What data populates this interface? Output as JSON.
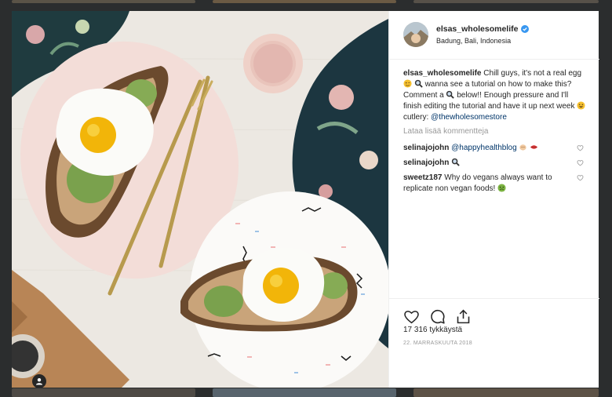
{
  "post": {
    "username": "elsas_wholesomelife",
    "location": "Badung, Bali, Indonesia",
    "caption": {
      "user": "elsas_wholesomelife",
      "text_1": "Chill guys, it's not a real egg",
      "text_2": "wanna see a tutorial on how to make this? Comment a",
      "text_3": "below!! Enough pressure and I'll finish editing the tutorial and have it up next week",
      "text_4": "cutlery:",
      "mention": "@thewholesomestore"
    },
    "load_more_label": "Lataa lisää kommentteja",
    "comments": [
      {
        "user": "selinajojohn",
        "text": "",
        "mention": "@happyhealthblog"
      },
      {
        "user": "selinajojohn",
        "text": "",
        "mention": ""
      },
      {
        "user": "sweetz187",
        "text": "Why do vegans always want to replicate non vegan foods!",
        "mention": ""
      }
    ],
    "likes": "17 316 tykkäystä",
    "date": "22. MARRASKUUTA 2018"
  },
  "icons": {
    "verified": "verified-badge-icon",
    "like": "heart-icon",
    "comment": "comment-bubble-icon",
    "share": "share-icon",
    "user_tag": "user-tag-icon"
  },
  "colors": {
    "verified": "#3897f0",
    "mention": "#003569",
    "muted": "#999999"
  }
}
